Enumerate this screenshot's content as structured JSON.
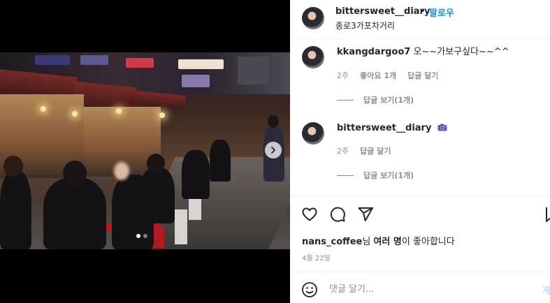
{
  "post": {
    "author": "bittersweet__diary",
    "separator": "•",
    "follow_label": "팔로우",
    "location": "종로3가포차거리",
    "more_label": "···"
  },
  "comments": [
    {
      "username": "kkangdargoo7",
      "text": "오~~가보구싶다~~^^",
      "time": "2주",
      "likes": "좋아요 1개",
      "reply_label": "답글 달기",
      "view_replies": "답글 보기(1개)"
    },
    {
      "username": "bittersweet__diary",
      "text": "",
      "emoji_icon": "camera-icon",
      "time": "2주",
      "reply_label": "답글 달기",
      "view_replies": "답글 보기(1개)"
    }
  ],
  "likes_summary": {
    "user": "nans_coffee",
    "suffix1": "님 ",
    "others": "여러 명",
    "suffix2": "이 좋아합니다"
  },
  "date": "4월 22일",
  "comment_box": {
    "placeholder": "댓글 달기...",
    "post_label": "게시"
  },
  "carousel": {
    "total": 2,
    "active": 1
  },
  "colors": {
    "link_blue": "#0095f6",
    "secondary_text": "#8e8e8e",
    "post_disabled": "#b2dffc"
  }
}
